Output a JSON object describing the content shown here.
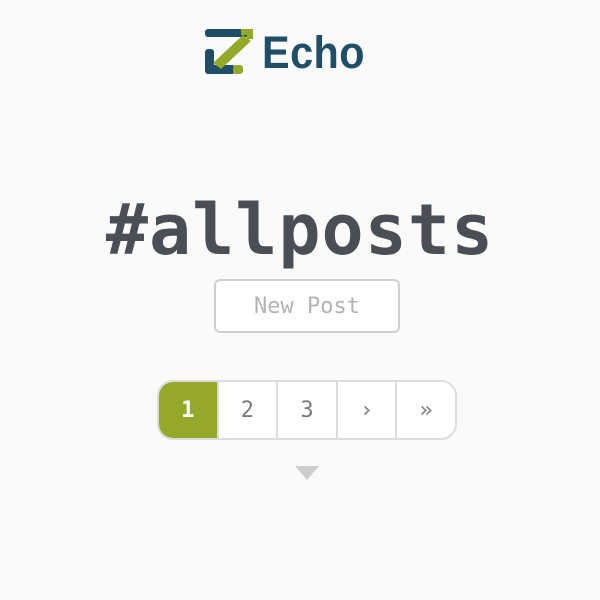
{
  "brand": {
    "name": "Echo",
    "colors": {
      "primary": "#1f4e66",
      "accent": "#95a82a"
    }
  },
  "heading": "#allposts",
  "actions": {
    "new_post_label": "New Post"
  },
  "pagination": {
    "pages": [
      "1",
      "2",
      "3"
    ],
    "next_label": "›",
    "last_label": "»",
    "current_page": "1"
  },
  "scroll_indicator": {
    "icon": "chevron-down-icon"
  }
}
